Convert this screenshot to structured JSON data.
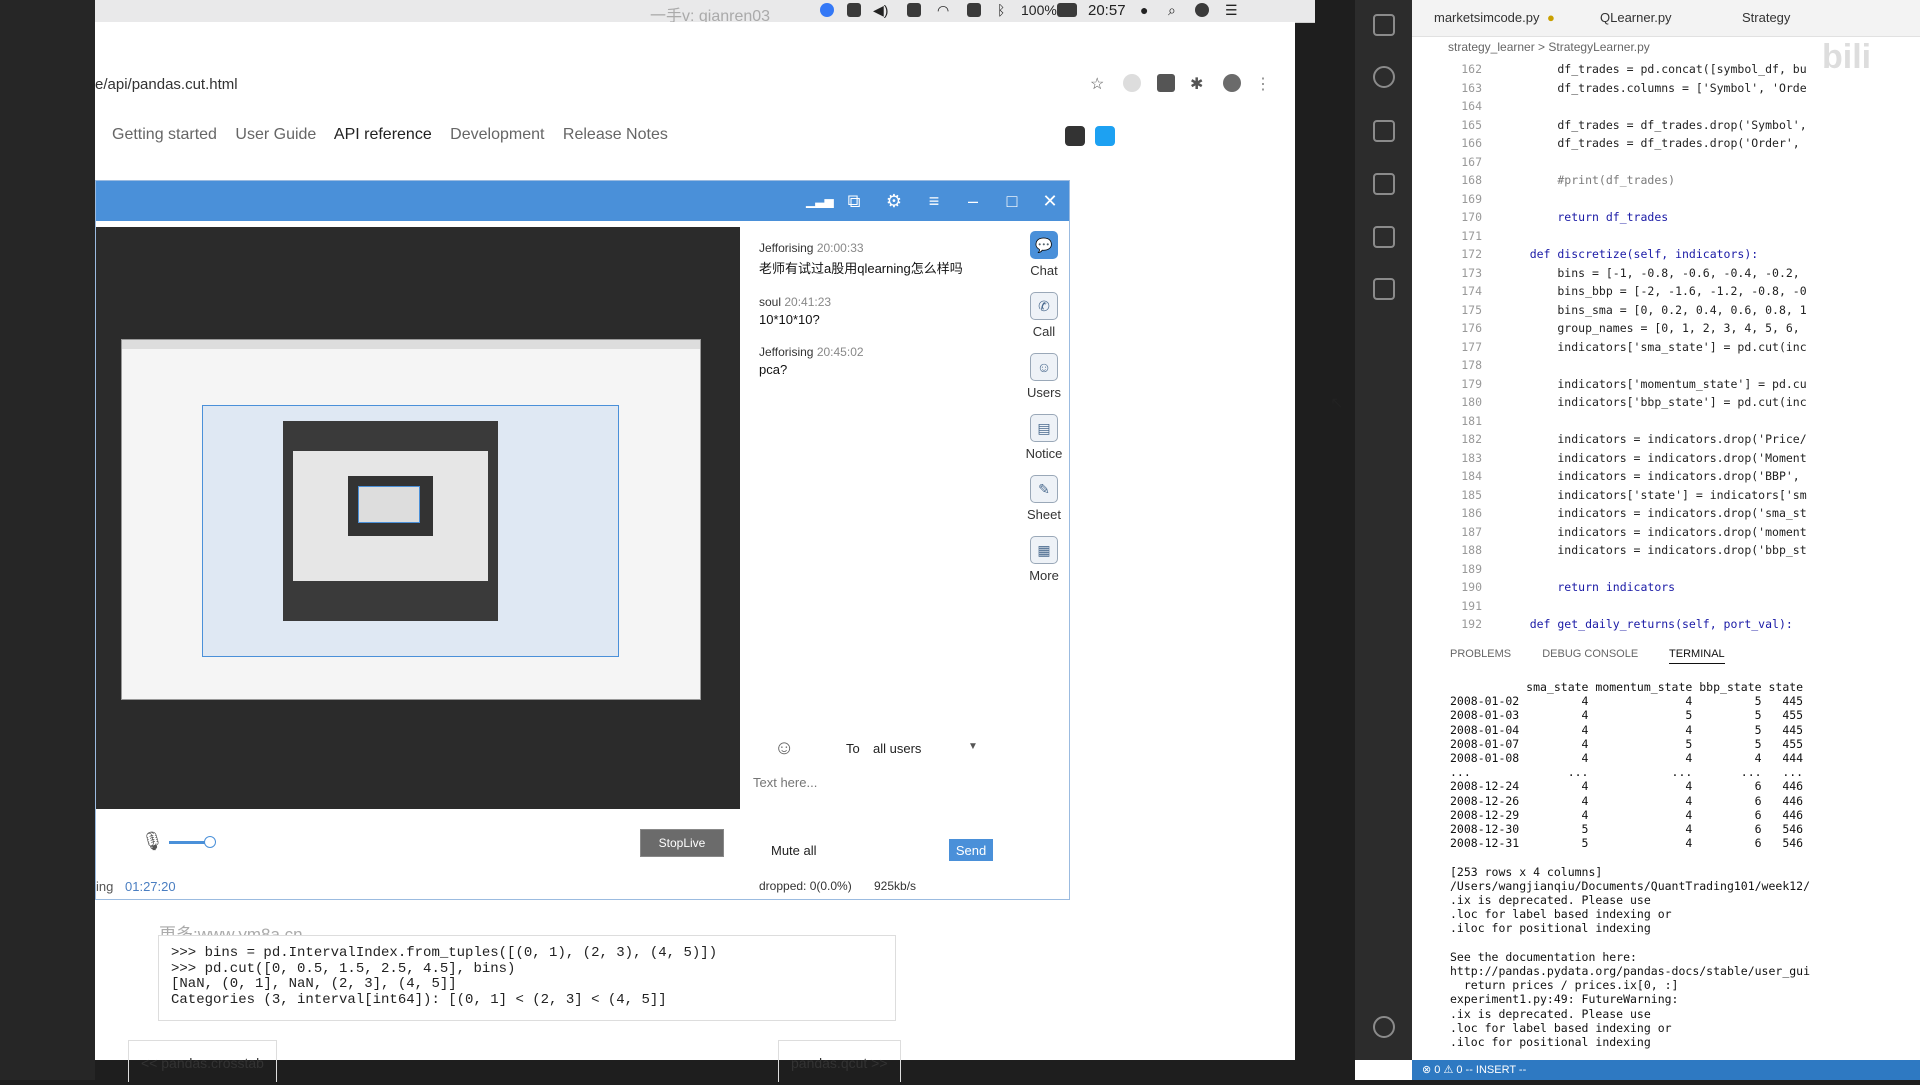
{
  "menubar": {
    "watermark": "一手v: qianren03",
    "battery": "100%",
    "time": "20:57"
  },
  "browser": {
    "url": "e/api/pandas.cut.html",
    "nav": [
      "Getting started",
      "User Guide",
      "API reference",
      "Development",
      "Release Notes"
    ],
    "watermark": "更多:www.ym8a.cn",
    "code_lines": [
      ">>> bins = pd.IntervalIndex.from_tuples([(0, 1), (2, 3), (4, 5)])",
      ">>> pd.cut([0, 0.5, 1.5, 2.5, 4.5], bins)",
      "[NaN, (0, 1], NaN, (2, 3], (4, 5]]",
      "Categories (3, interval[int64]): [(0, 1] < (2, 3] < (4, 5]]"
    ],
    "prev_link": "<< pandas.crosstab",
    "next_link": "pandas.qcut >>"
  },
  "chat": {
    "messages": [
      {
        "user": "Jefforising",
        "time": "20:00:33",
        "text": "老师有试过a股用qlearning怎么样吗"
      },
      {
        "user": "soul",
        "time": "20:41:23",
        "text": "10*10*10?"
      },
      {
        "user": "Jefforising",
        "time": "20:45:02",
        "text": "pca?"
      }
    ],
    "sidebar": [
      "Chat",
      "Call",
      "Users",
      "Notice",
      "Sheet",
      "More"
    ],
    "to_label": "To",
    "to_value": "all users",
    "placeholder": "Text here...",
    "mute_all": "Mute all",
    "send": "Send",
    "stop_live": "StopLive",
    "live_label": "ing",
    "live_time": "01:27:20",
    "dropped": "dropped: 0(0.0%)",
    "rate": "925kb/s"
  },
  "vscode": {
    "tabs": [
      "marketsimcode.py",
      "QLearner.py",
      "Strategy"
    ],
    "breadcrumb": "strategy_learner > StrategyLearner.py",
    "lines": [
      {
        "n": "162",
        "t": "        df_trades = pd.concat([symbol_df, bu"
      },
      {
        "n": "163",
        "t": "        df_trades.columns = ['Symbol', 'Orde"
      },
      {
        "n": "164",
        "t": ""
      },
      {
        "n": "165",
        "t": "        df_trades = df_trades.drop('Symbol',"
      },
      {
        "n": "166",
        "t": "        df_trades = df_trades.drop('Order',"
      },
      {
        "n": "167",
        "t": ""
      },
      {
        "n": "168",
        "t": "        #print(df_trades)"
      },
      {
        "n": "169",
        "t": ""
      },
      {
        "n": "170",
        "t": "        return df_trades"
      },
      {
        "n": "171",
        "t": ""
      },
      {
        "n": "172",
        "t": "    def discretize(self, indicators):"
      },
      {
        "n": "173",
        "t": "        bins = [-1, -0.8, -0.6, -0.4, -0.2,"
      },
      {
        "n": "174",
        "t": "        bins_bbp = [-2, -1.6, -1.2, -0.8, -0"
      },
      {
        "n": "175",
        "t": "        bins_sma = [0, 0.2, 0.4, 0.6, 0.8, 1"
      },
      {
        "n": "176",
        "t": "        group_names = [0, 1, 2, 3, 4, 5, 6,"
      },
      {
        "n": "177",
        "t": "        indicators['sma_state'] = pd.cut(inc"
      },
      {
        "n": "178",
        "t": ""
      },
      {
        "n": "179",
        "t": "        indicators['momentum_state'] = pd.cu"
      },
      {
        "n": "180",
        "t": "        indicators['bbp_state'] = pd.cut(inc"
      },
      {
        "n": "181",
        "t": ""
      },
      {
        "n": "182",
        "t": "        indicators = indicators.drop('Price/"
      },
      {
        "n": "183",
        "t": "        indicators = indicators.drop('Moment"
      },
      {
        "n": "184",
        "t": "        indicators = indicators.drop('BBP',"
      },
      {
        "n": "185",
        "t": "        indicators['state'] = indicators['sm"
      },
      {
        "n": "186",
        "t": "        indicators = indicators.drop('sma_st"
      },
      {
        "n": "187",
        "t": "        indicators = indicators.drop('moment"
      },
      {
        "n": "188",
        "t": "        indicators = indicators.drop('bbp_st"
      },
      {
        "n": "189",
        "t": ""
      },
      {
        "n": "190",
        "t": "        return indicators"
      },
      {
        "n": "191",
        "t": ""
      },
      {
        "n": "192",
        "t": "    def get_daily_returns(self, port_val):"
      }
    ],
    "panel_tabs": [
      "PROBLEMS",
      "DEBUG CONSOLE",
      "TERMINAL"
    ],
    "terminal": [
      "           sma_state momentum_state bbp_state state",
      "2008-01-02         4              4         5   445",
      "2008-01-03         4              5         5   455",
      "2008-01-04         4              4         5   445",
      "2008-01-07         4              5         5   455",
      "2008-01-08         4              4         4   444",
      "...              ...            ...       ...   ...",
      "2008-12-24         4              4         6   446",
      "2008-12-26         4              4         6   446",
      "2008-12-29         4              4         6   446",
      "2008-12-30         5              4         6   546",
      "2008-12-31         5              4         6   546",
      "",
      "[253 rows x 4 columns]",
      "/Users/wangjianqiu/Documents/QuantTrading101/week12/",
      ".ix is deprecated. Please use",
      ".loc for label based indexing or",
      ".iloc for positional indexing",
      "",
      "See the documentation here:",
      "http://pandas.pydata.org/pandas-docs/stable/user_gui",
      "  return prices / prices.ix[0, :]",
      "experiment1.py:49: FutureWarning:",
      ".ix is deprecated. Please use",
      ".loc for label based indexing or",
      ".iloc for positional indexing"
    ],
    "status": "⊗ 0 ⚠ 0    -- INSERT --",
    "bili": "bili"
  }
}
